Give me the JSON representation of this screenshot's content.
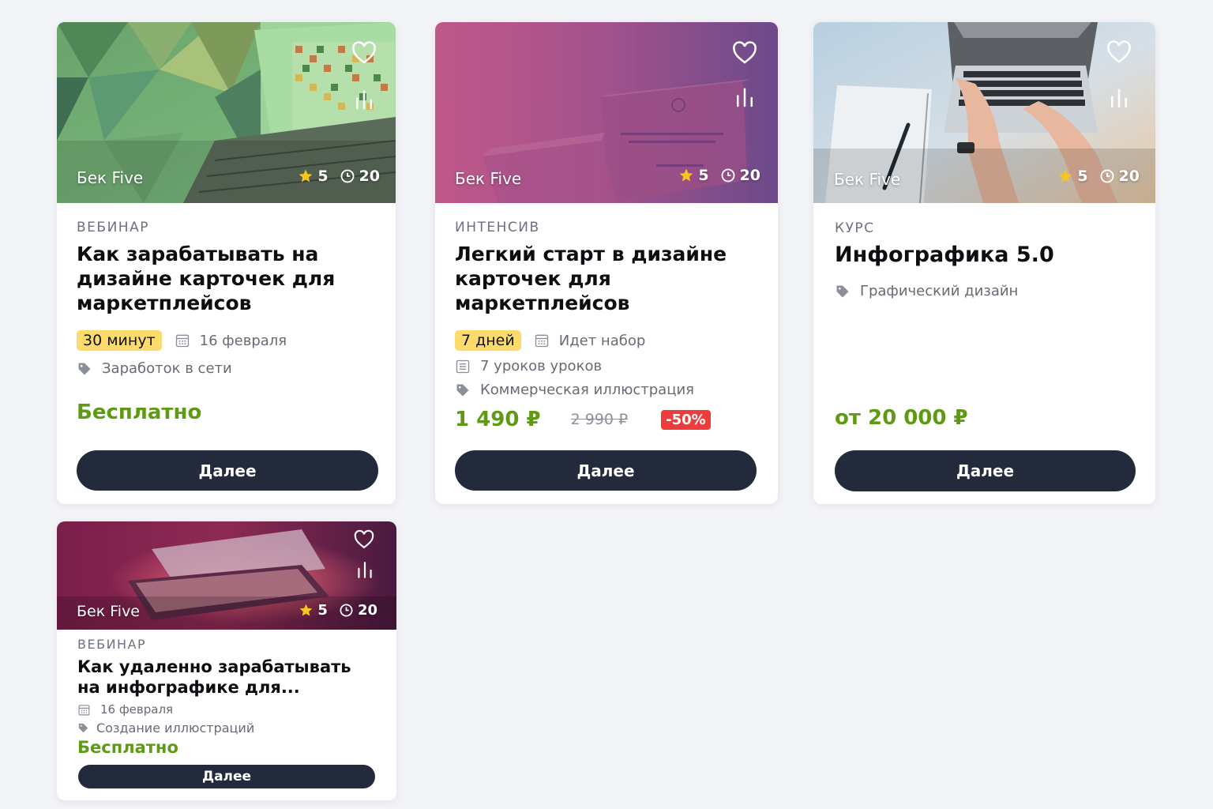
{
  "cards": [
    {
      "author": "Бек Five",
      "rating": "5",
      "duration": "20",
      "type": "Вебинар",
      "title": "Как зарабатывать на дизайне карточек для маркетплейсов",
      "badge": "30 минут",
      "date": "16 февраля",
      "tag": "Заработок в сети",
      "price": "Бесплатно",
      "button": "Далее",
      "icons": {
        "favorite": "heart-icon",
        "stats": "bar-chart-icon",
        "rating": "star-icon",
        "duration": "clock-icon",
        "date": "calendar-icon",
        "tag": "tag-icon"
      }
    },
    {
      "author": "Бек Five",
      "rating": "5",
      "duration": "20",
      "type": "Интенсив",
      "title": "Легкий старт в дизайне карточек для маркетплейсов",
      "badge": "7 дней",
      "status": "Идет набор",
      "lessons": "7 уроков уроков",
      "tag": "Коммерческая иллюстрация",
      "price": "1 490 ₽",
      "old_price": "2 990 ₽",
      "discount": "-50%",
      "button": "Далее",
      "icons": {
        "favorite": "heart-icon",
        "stats": "bar-chart-icon",
        "rating": "star-icon",
        "duration": "clock-icon",
        "status": "calendar-icon",
        "lessons": "list-icon",
        "tag": "tag-icon"
      }
    },
    {
      "author": "Бек Five",
      "rating": "5",
      "duration": "20",
      "type": "Курс",
      "title": "Инфографика 5.0",
      "tag": "Графический дизайн",
      "price": "от 20 000 ₽",
      "button": "Далее",
      "icons": {
        "favorite": "heart-icon",
        "stats": "bar-chart-icon",
        "rating": "star-icon",
        "duration": "clock-icon",
        "tag": "tag-icon"
      }
    },
    {
      "author": "Бек Five",
      "rating": "5",
      "duration": "20",
      "type": "Вебинар",
      "title": "Как удаленно зарабатывать на инфографике для...",
      "date": "16 февраля",
      "tag": "Создание иллюстраций",
      "price": "Бесплатно",
      "button": "Далее",
      "icons": {
        "favorite": "heart-icon",
        "stats": "bar-chart-icon",
        "rating": "star-icon",
        "duration": "clock-icon",
        "date": "calendar-icon",
        "tag": "tag-icon"
      }
    }
  ],
  "colors": {
    "page_bg": "#f3f4f7",
    "card_bg": "#ffffff",
    "button_bg": "#232a3b",
    "price_green": "#5f9a14",
    "badge_yellow": "#fbdb6b",
    "discount_red": "#ee3b3b",
    "star_yellow": "#f7c51e"
  }
}
